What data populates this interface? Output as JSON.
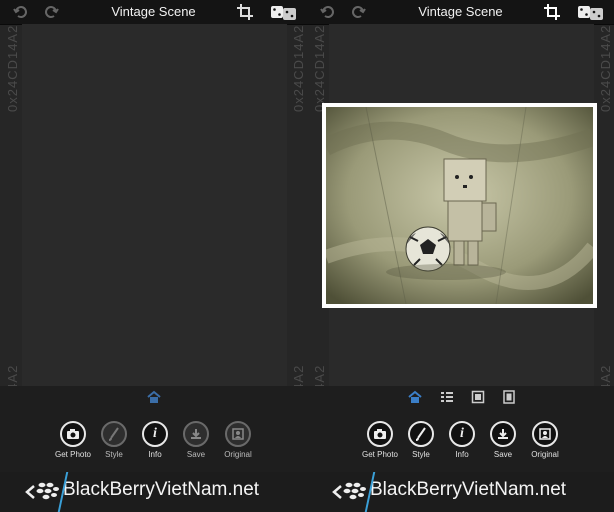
{
  "app_title": "Vintage Scene",
  "watermark": "0x24CD14A2",
  "brand": "BlackBerryVietNam.net",
  "tools": [
    {
      "label": "Get Photo",
      "icon": "camera-icon"
    },
    {
      "label": "Style",
      "icon": "brush-icon"
    },
    {
      "label": "Info",
      "icon": "info-icon"
    },
    {
      "label": "Save",
      "icon": "save-icon"
    },
    {
      "label": "Original",
      "icon": "original-icon"
    }
  ],
  "tabs": [
    "scene-tab-icon",
    "list-tab-icon",
    "frame-tab-icon",
    "film-tab-icon"
  ],
  "colors": {
    "accent": "#3aa0d8",
    "topbar": "#141414",
    "background": "#262626"
  }
}
